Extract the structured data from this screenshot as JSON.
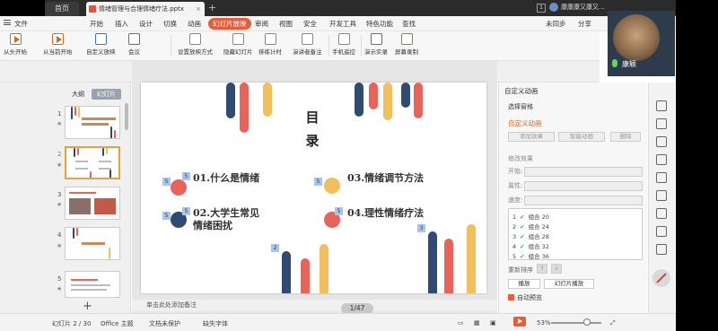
{
  "titlebar": {
    "home_tab": "首页",
    "doc_tab": "情绪管理与合理情绪疗法.pptx",
    "user_count": "1",
    "user_name": "康康康又康又..."
  },
  "menu": {
    "file": "文件",
    "items": [
      "开始",
      "插入",
      "设计",
      "切换",
      "动画",
      "幻灯片放映",
      "审阅",
      "视图",
      "安全",
      "开发工具",
      "特色功能",
      "查找"
    ],
    "active_index": 5,
    "right": [
      "未同步",
      "分享"
    ]
  },
  "ribbon": {
    "buttons": [
      "从头开始",
      "从当前开始",
      "自定义放映",
      "会议",
      "设置放映方式",
      "隐藏幻灯片",
      "排练计时",
      "演讲者备注",
      "手机遥控",
      "演示实录",
      "屏幕录制"
    ]
  },
  "left_panel": {
    "tab_outline": "大纲",
    "tab_slides": "幻灯片",
    "slide_numbers": [
      "1",
      "2",
      "3",
      "4",
      "5"
    ],
    "add": "+"
  },
  "slide": {
    "title": "目录",
    "items": [
      "01.什么是情绪",
      "02.大学生常见\n情绪困扰",
      "03.情绪调节方法",
      "04.理性情绪疗法"
    ],
    "tags": [
      "5",
      "5",
      "5",
      "5",
      "5",
      "5",
      "2",
      "3"
    ]
  },
  "notes_placeholder": "单击此处添加备注",
  "page_indicator": "1/47",
  "right_panel": {
    "title": "自定义动画",
    "select_pane": "选择窗格",
    "section": "自定义动画",
    "add_effect": "添加效果",
    "smart_anim": "智能动画",
    "delete": "删除",
    "modify": "修改效果",
    "start_label": "开始:",
    "prop_label": "属性:",
    "speed_label": "速度:",
    "list": [
      {
        "num": "1",
        "name": "组合 20"
      },
      {
        "num": "2",
        "name": "组合 24"
      },
      {
        "num": "3",
        "name": "组合 28"
      },
      {
        "num": "4",
        "name": "组合 32"
      },
      {
        "num": "5",
        "name": "组合 36"
      }
    ],
    "reorder": "重新排序",
    "play": "播放",
    "slideshow": "幻灯片播放",
    "autopreview": "自动预览"
  },
  "video": {
    "name": "康颖"
  },
  "statusbar": {
    "slide_info": "幻灯片 2 / 30",
    "theme": "Office 主题",
    "protect": "文档未保护",
    "font_missing": "缺失字体",
    "zoom": "53%"
  },
  "colors": {
    "accent": "#e55e3b",
    "navy": "#2f4a73",
    "red": "#e8635a",
    "yellow": "#f1bf5b"
  }
}
